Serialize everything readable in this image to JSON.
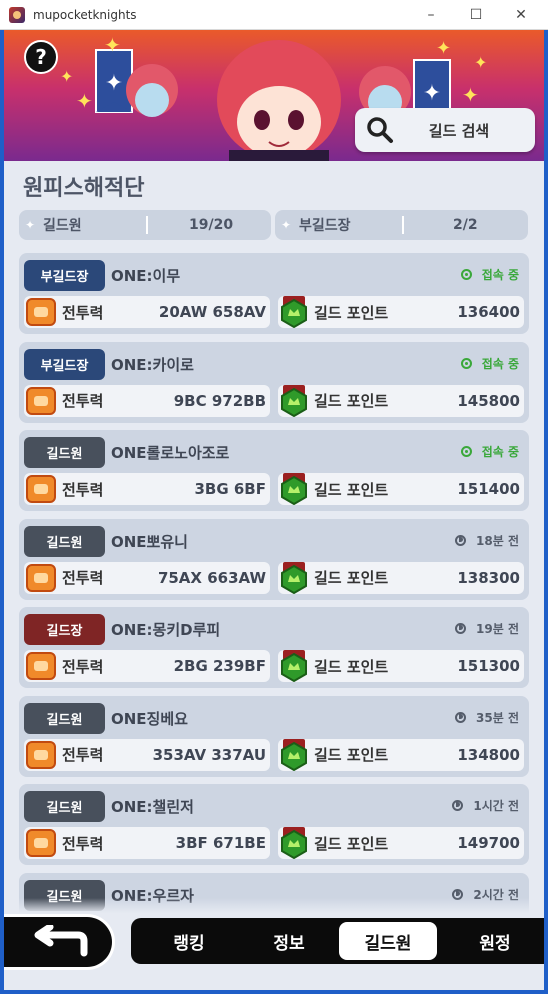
{
  "window": {
    "title": "mupocketknights",
    "minimize": "–",
    "maximize": "☐",
    "close": "✕"
  },
  "banner": {
    "help": "?",
    "search_label": "길드 검색",
    "search_icon": "magnifier-icon"
  },
  "guild": {
    "name": "원피스해적단",
    "members_label": "길드원",
    "members_value": "19/20",
    "vice_label": "부길드장",
    "vice_value": "2/2"
  },
  "labels": {
    "power": "전투력",
    "points": "길드 포인트"
  },
  "members": [
    {
      "role": "부길드장",
      "role_color": "#2b4879",
      "name": "ONE:이무",
      "status": "접속 중",
      "online": true,
      "power": "20AW 658AV",
      "points": "136400"
    },
    {
      "role": "부길드장",
      "role_color": "#2b4879",
      "name": "ONE:카이로",
      "status": "접속 중",
      "online": true,
      "power": "9BC 972BB",
      "points": "145800"
    },
    {
      "role": "길드원",
      "role_color": "#48505c",
      "name": "ONE롤로노아조로",
      "status": "접속 중",
      "online": true,
      "power": "3BG 6BF",
      "points": "151400"
    },
    {
      "role": "길드원",
      "role_color": "#48505c",
      "name": "ONE뽀유니",
      "status": "18분 전",
      "online": false,
      "power": "75AX 663AW",
      "points": "138300"
    },
    {
      "role": "길드장",
      "role_color": "#7f2525",
      "name": "ONE:몽키D루피",
      "status": "19분 전",
      "online": false,
      "power": "2BG 239BF",
      "points": "151300"
    },
    {
      "role": "길드원",
      "role_color": "#48505c",
      "name": "ONE징베요",
      "status": "35분 전",
      "online": false,
      "power": "353AV 337AU",
      "points": "134800"
    },
    {
      "role": "길드원",
      "role_color": "#48505c",
      "name": "ONE:챌린저",
      "status": "1시간 전",
      "online": false,
      "power": "3BF 671BE",
      "points": "149700"
    },
    {
      "role": "길드원",
      "role_color": "#48505c",
      "name": "ONE:우르자",
      "status": "2시간 전",
      "online": false,
      "power": "",
      "points": ""
    }
  ],
  "tabs": [
    {
      "label": "랭킹",
      "active": false
    },
    {
      "label": "정보",
      "active": false
    },
    {
      "label": "길드원",
      "active": true
    },
    {
      "label": "원정",
      "active": false
    }
  ],
  "colors": {
    "online": "#3aa83a",
    "offline": "#555d6b",
    "window_border": "#1f5fc8",
    "background": "#e6eaf2"
  }
}
